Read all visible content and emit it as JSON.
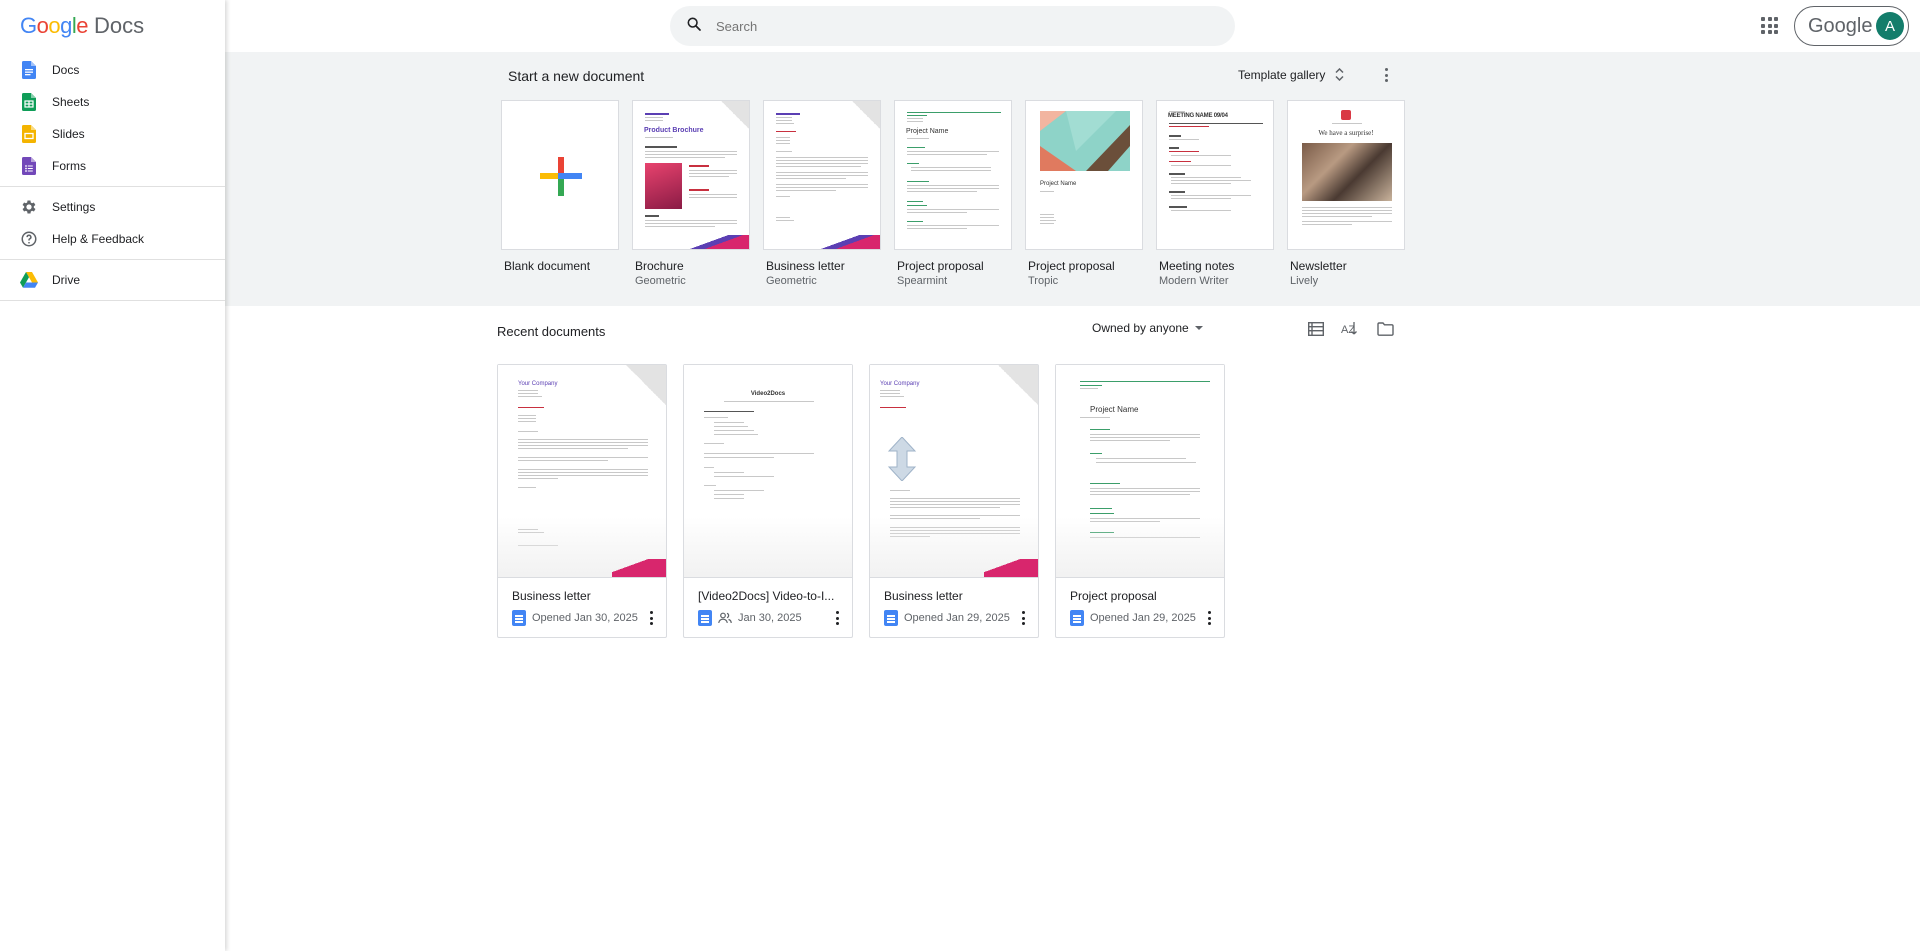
{
  "app": {
    "brand_google": "Google",
    "brand_docs": "Docs"
  },
  "sidebar": {
    "items": [
      {
        "label": "Docs",
        "icon": "docs-icon",
        "color": "#4285f4"
      },
      {
        "label": "Sheets",
        "icon": "sheets-icon",
        "color": "#0f9d58"
      },
      {
        "label": "Slides",
        "icon": "slides-icon",
        "color": "#f4b400"
      },
      {
        "label": "Forms",
        "icon": "forms-icon",
        "color": "#7248b9"
      }
    ],
    "settings": "Settings",
    "help": "Help & Feedback",
    "drive": "Drive"
  },
  "header": {
    "search_placeholder": "Search",
    "account_word": "Google",
    "avatar_letter": "A",
    "avatar_color": "#137d6b"
  },
  "templates": {
    "title": "Start a new document",
    "gallery_label": "Template gallery",
    "items": [
      {
        "name": "Blank document",
        "sub": ""
      },
      {
        "name": "Brochure",
        "sub": "Geometric"
      },
      {
        "name": "Business letter",
        "sub": "Geometric"
      },
      {
        "name": "Project proposal",
        "sub": "Spearmint"
      },
      {
        "name": "Project proposal",
        "sub": "Tropic"
      },
      {
        "name": "Meeting notes",
        "sub": "Modern Writer"
      },
      {
        "name": "Newsletter",
        "sub": "Lively"
      }
    ],
    "thumb_text": {
      "brochure_title": "Product Brochure",
      "proposal_title": "Project Name",
      "tropic_title": "Project Name",
      "meeting_title": "MEETING NAME 09/04",
      "newsletter_title": "We have a surprise!"
    }
  },
  "recent": {
    "title": "Recent documents",
    "owner_filter": "Owned by anyone",
    "docs": [
      {
        "name": "Business letter",
        "meta": "Opened Jan 30, 2025",
        "shared": false
      },
      {
        "name": "[Video2Docs] Video-to-I...",
        "meta": "Jan 30, 2025",
        "shared": true
      },
      {
        "name": "Business letter",
        "meta": "Opened Jan 29, 2025",
        "shared": false
      },
      {
        "name": "Project proposal",
        "meta": "Opened Jan 29, 2025",
        "shared": false
      }
    ],
    "thumb_text": {
      "company": "Your Company",
      "video2docs": "Video2Docs",
      "project_name": "Project Name"
    }
  }
}
